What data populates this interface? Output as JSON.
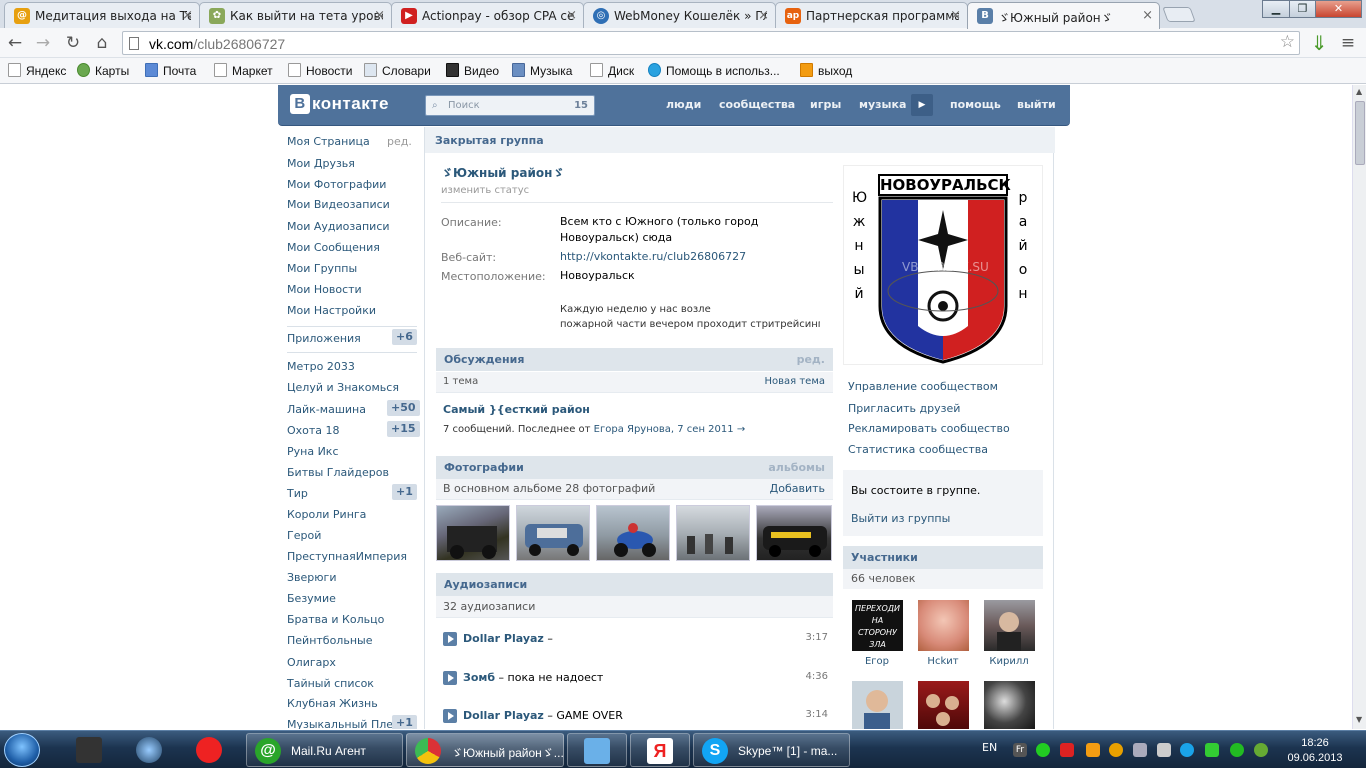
{
  "browser": {
    "tabs": [
      {
        "label": "Медитация выхода на Те",
        "favicon": "mailru-agent-icon"
      },
      {
        "label": "Как выйти на тета урове",
        "favicon": "tree-icon"
      },
      {
        "label": "Actionpay - обзор CPA се",
        "favicon": "youtube-icon"
      },
      {
        "label": "WebMoney Кошелёк » Гл",
        "favicon": "webmoney-icon"
      },
      {
        "label": "Партнерская программа",
        "favicon": "ap-icon"
      },
      {
        "label": "ゞЮжный районゞ",
        "favicon": "vk-icon"
      }
    ],
    "fav_letters": {
      "ap": "ap",
      "vk": "B"
    },
    "url_host": "vk.com",
    "url_path": "/club26806727",
    "bookmarks": [
      "Яндекс",
      "Карты",
      "Почта",
      "Маркет",
      "Новости",
      "Словари",
      "Видео",
      "Музыка",
      "Диск",
      "Помощь в использ...",
      "выход"
    ]
  },
  "vk": {
    "logo": "контакте",
    "logo_letter": "В",
    "search_placeholder": "Поиск",
    "search_count": "15",
    "nav": [
      "люди",
      "сообщества",
      "игры",
      "музыка",
      "помощь",
      "выйти"
    ],
    "left_menu": {
      "my_page": "Моя Страница",
      "edit": "ред.",
      "items": [
        "Мои Друзья",
        "Мои Фотографии",
        "Мои Видеозаписи",
        "Мои Аудиозаписи",
        "Мои Сообщения",
        "Мои Группы",
        "Мои Новости",
        "Мои Настройки"
      ],
      "apps": "Приложения",
      "apps_count": "+6",
      "games": [
        {
          "label": "Метро 2033",
          "count": ""
        },
        {
          "label": "Целуй и Знакомься",
          "count": ""
        },
        {
          "label": "Лайк-машина",
          "count": "+50"
        },
        {
          "label": "Охота 18",
          "count": "+15"
        },
        {
          "label": "Руна Икс",
          "count": ""
        },
        {
          "label": "Битвы Глайдеров",
          "count": ""
        },
        {
          "label": "Тир",
          "count": "+1"
        },
        {
          "label": "Короли Ринга",
          "count": ""
        },
        {
          "label": "Герой",
          "count": ""
        },
        {
          "label": "ПреступнаяИмперия",
          "count": ""
        },
        {
          "label": "Зверюги",
          "count": ""
        },
        {
          "label": "Безумие",
          "count": ""
        },
        {
          "label": "Братва и Кольцо",
          "count": ""
        },
        {
          "label": "Пейнтбольные",
          "count": ""
        },
        {
          "label": "Олигарх",
          "count": ""
        },
        {
          "label": "Тайный список",
          "count": ""
        },
        {
          "label": "Клубная Жизнь",
          "count": ""
        },
        {
          "label": "Музыкальный Плеер",
          "count": "+1"
        }
      ]
    },
    "group": {
      "type": "Закрытая группа",
      "name": "ゞЮжный районゞ",
      "status": "изменить статус",
      "desc_label": "Описание:",
      "desc_value": "Всем кто с Южного (только город Новоуральск) сюда",
      "site_label": "Веб-сайт:",
      "site_value": "http://vkontakte.ru/club26806727",
      "loc_label": "Местоположение:",
      "loc_value": "Новоуральск",
      "note_line1": "Каждую неделю у нас возле",
      "note_line2": "пожарной части вечером проходит стритрейсинг"
    },
    "discussions": {
      "title": "Обсуждения",
      "edit": "ред.",
      "count": "1 тема",
      "new": "Новая тема",
      "topic": "Самый }{есткий район",
      "meta_prefix": "7 сообщений. Последнее от",
      "meta_author": "Егора Ярунова,",
      "meta_date": "7 сен 2011",
      "arrow": "→"
    },
    "photos": {
      "title": "Фотографии",
      "albums": "альбомы",
      "sub": "В основном альбоме 28 фотографий",
      "add": "Добавить"
    },
    "audio": {
      "title": "Аудиозаписи",
      "count": "32 аудиозаписи",
      "tracks": [
        {
          "artist": "Dollar Playaz",
          "title": " – ",
          "dur": "3:17"
        },
        {
          "artist": "Зомб",
          "title": " – пока не надоест",
          "dur": "4:36"
        },
        {
          "artist": "Dollar Playaz",
          "title": " – GAME OVER",
          "dur": "3:14"
        }
      ]
    },
    "right": {
      "crest_title": "НОВОУРАЛЬСК",
      "side_left": [
        "Ю",
        "ж",
        "н",
        "ы",
        "й"
      ],
      "side_right": [
        "р",
        "а",
        "й",
        "о",
        "н"
      ],
      "watermark": "VBISTREKK.SU",
      "links": [
        "Управление сообществом",
        "Пригласить друзей",
        "Рекламировать сообщество",
        "Статистика сообщества"
      ],
      "member_status": "Вы состоите в группе.",
      "leave": "Выйти из группы",
      "members_title": "Участники",
      "members_count": "66 человек",
      "members": [
        "Егор",
        "Нсkит",
        "Кирилл"
      ],
      "avatar_text": "ПЕРЕХОДИ НА СТОРОНУ ЗЛА"
    }
  },
  "taskbar": {
    "mailru_label": "Mail.Ru Агент",
    "chrome_label": "ゞЮжный районゞ...",
    "skype_label": "Skype™ [1] - ma...",
    "lang": "EN",
    "time": "18:26",
    "date": "09.06.2013",
    "colors": {
      "accent": "#4f729b",
      "link": "#2b587a"
    }
  }
}
